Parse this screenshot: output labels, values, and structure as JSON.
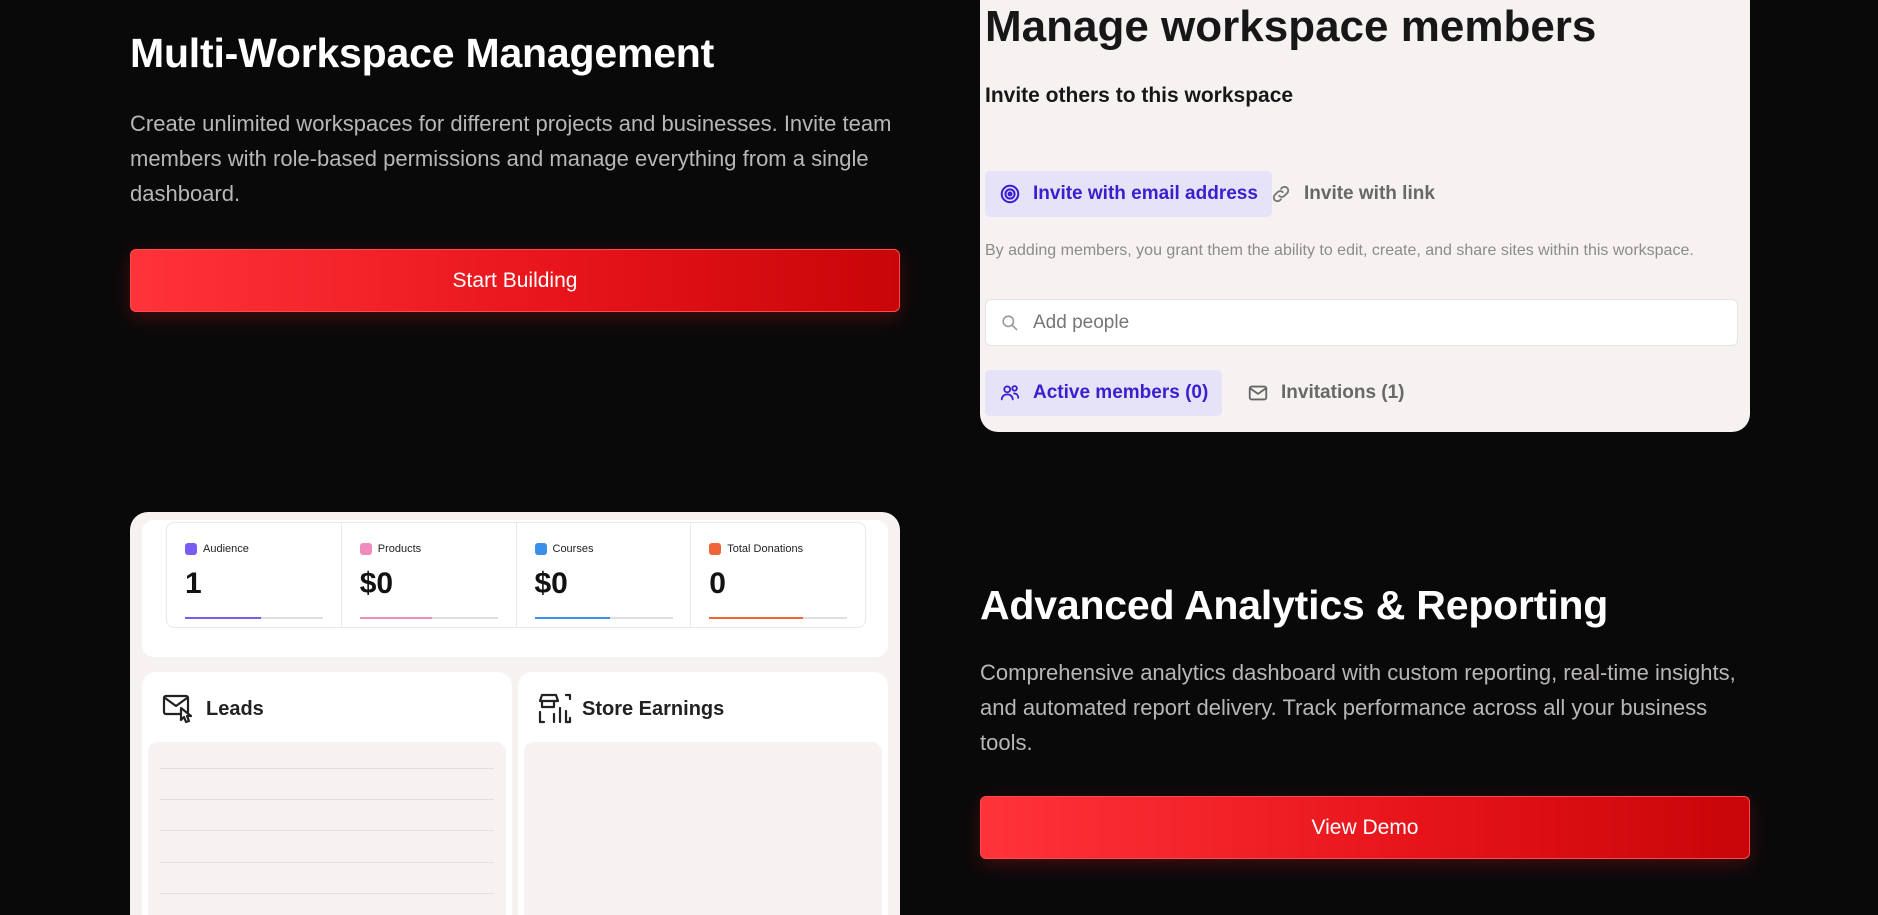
{
  "feature1": {
    "title": "Multi-Workspace Management",
    "description": "Create unlimited workspaces for different projects and businesses. Invite team members with role-based permissions and manage everything from a single dashboard.",
    "cta_label": "Start Building"
  },
  "members_panel": {
    "title": "Manage workspace members",
    "subtitle": "Invite others to this workspace",
    "tabs": [
      {
        "label": "Invite with email address",
        "icon": "at-sign-icon",
        "active": true
      },
      {
        "label": "Invite with link",
        "icon": "link-icon",
        "active": false
      }
    ],
    "note": "By adding members, you grant them the ability to edit, create, and share sites within this workspace.",
    "search": {
      "placeholder": "Add people",
      "value": ""
    },
    "member_tabs": [
      {
        "label": "Active members (0)",
        "icon": "users-icon",
        "active": true
      },
      {
        "label": "Invitations (1)",
        "icon": "mail-icon",
        "active": false
      }
    ]
  },
  "dashboard": {
    "stats": [
      {
        "label": "Audience",
        "value": "1",
        "color": "#7a5cf0",
        "progress": 0.55
      },
      {
        "label": "Products",
        "value": "$0",
        "color": "#f28bbd",
        "progress": 0.52
      },
      {
        "label": "Courses",
        "value": "$0",
        "color": "#3b8fe8",
        "progress": 0.55
      },
      {
        "label": "Total Donations",
        "value": "0",
        "color": "#f0643c",
        "progress": 0.68
      }
    ],
    "cards": [
      {
        "title": "Leads",
        "icon": "mail-cursor-icon"
      },
      {
        "title": "Store Earnings",
        "icon": "store-chart-icon"
      }
    ]
  },
  "feature2": {
    "title": "Advanced Analytics & Reporting",
    "description": "Comprehensive analytics dashboard with custom reporting, real-time insights, and automated report delivery. Track performance across all your business tools.",
    "cta_label": "View Demo"
  },
  "colors": {
    "background": "#0a090a",
    "accent": "#e8151b",
    "active_tab_text": "#3a1fcf",
    "active_tab_bg": "#e6e2f7"
  }
}
